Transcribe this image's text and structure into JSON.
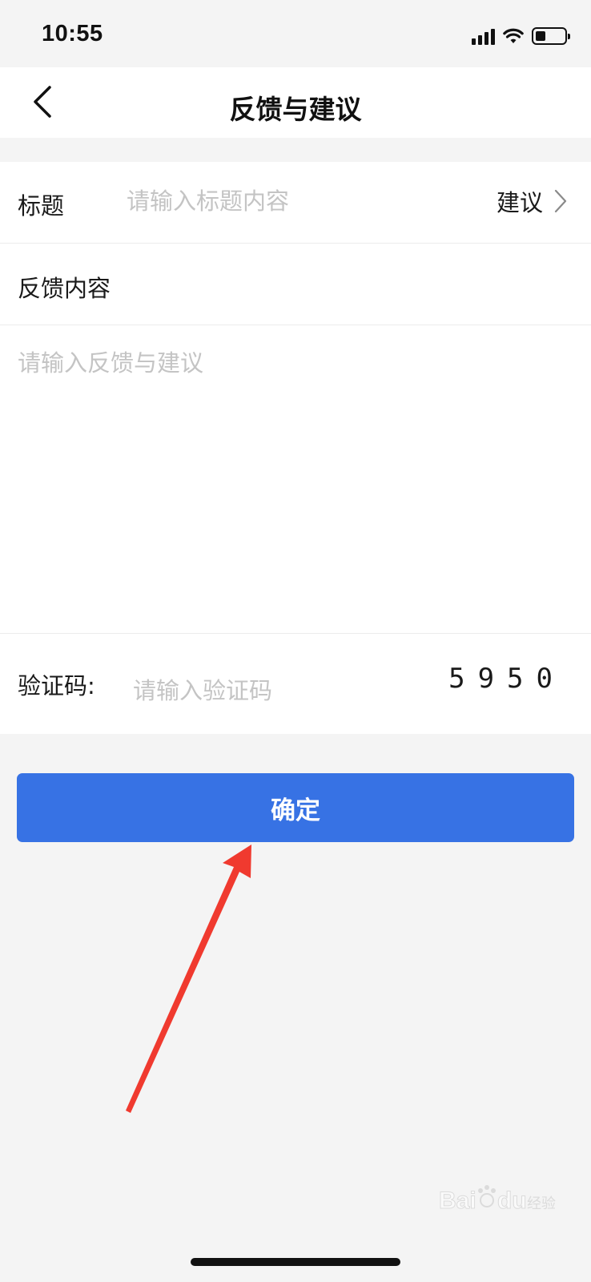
{
  "status_bar": {
    "time": "10:55"
  },
  "nav": {
    "title": "反馈与建议"
  },
  "form": {
    "title_label": "标题",
    "title_placeholder": "请输入标题内容",
    "category_value": "建议",
    "content_label": "反馈内容",
    "content_placeholder": "请输入反馈与建议",
    "captcha_label": "验证码:",
    "captcha_placeholder": "请输入验证码",
    "captcha_code": "5950"
  },
  "actions": {
    "confirm_label": "确定"
  },
  "colors": {
    "accent": "#3772e4",
    "annotation_arrow": "#f03a2f",
    "background": "#f4f4f4"
  },
  "watermark": {
    "text": "Baidu 经验"
  }
}
